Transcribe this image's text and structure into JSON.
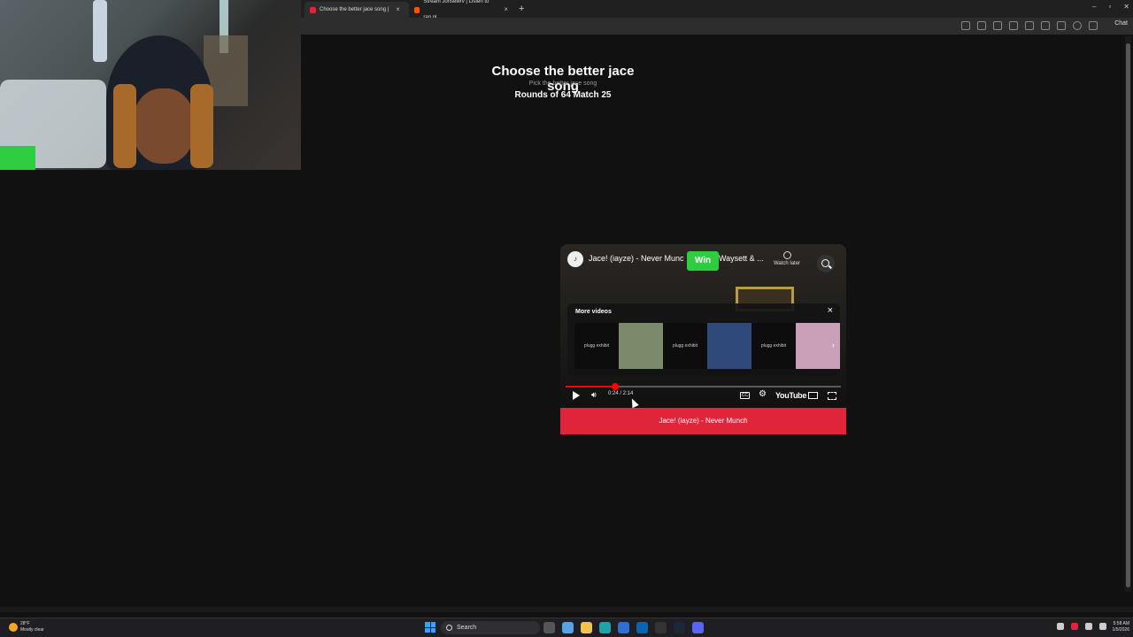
{
  "browser": {
    "tabs": [
      {
        "title": "Choose the better jace song |",
        "active": true,
        "favicon_color": "#e0243a"
      },
      {
        "title": "Stream Jonsewrv | Listen to rap pl",
        "active": false,
        "favicon_color": "#ff5500"
      }
    ],
    "chat_label": "Chat"
  },
  "page": {
    "title": "Choose the better jace song",
    "subtitle": "Pick the better jace song",
    "round": "Rounds of 64 Match 25"
  },
  "video": {
    "title_left": "Jace! (iayze) - Never Munc",
    "title_right": "Waysett & ...",
    "win_label": "Win",
    "watch_later": "Watch later",
    "more_videos": "More videos",
    "progress": 0.18,
    "time": "0:24 / 2:14",
    "youtube_label": "YouTube",
    "thumb_label": "plugg exhibit",
    "thumb_colors": [
      "#7a8a6a",
      "#2f4a7a",
      "#c9a0b8"
    ]
  },
  "choose_button": "Jace! (iayze) - Never Munch",
  "taskbar": {
    "weather_temp": "28°F",
    "weather_desc": "Mostly clear",
    "search_label": "Search",
    "time": "5:58 AM",
    "date": "1/5/2026"
  }
}
